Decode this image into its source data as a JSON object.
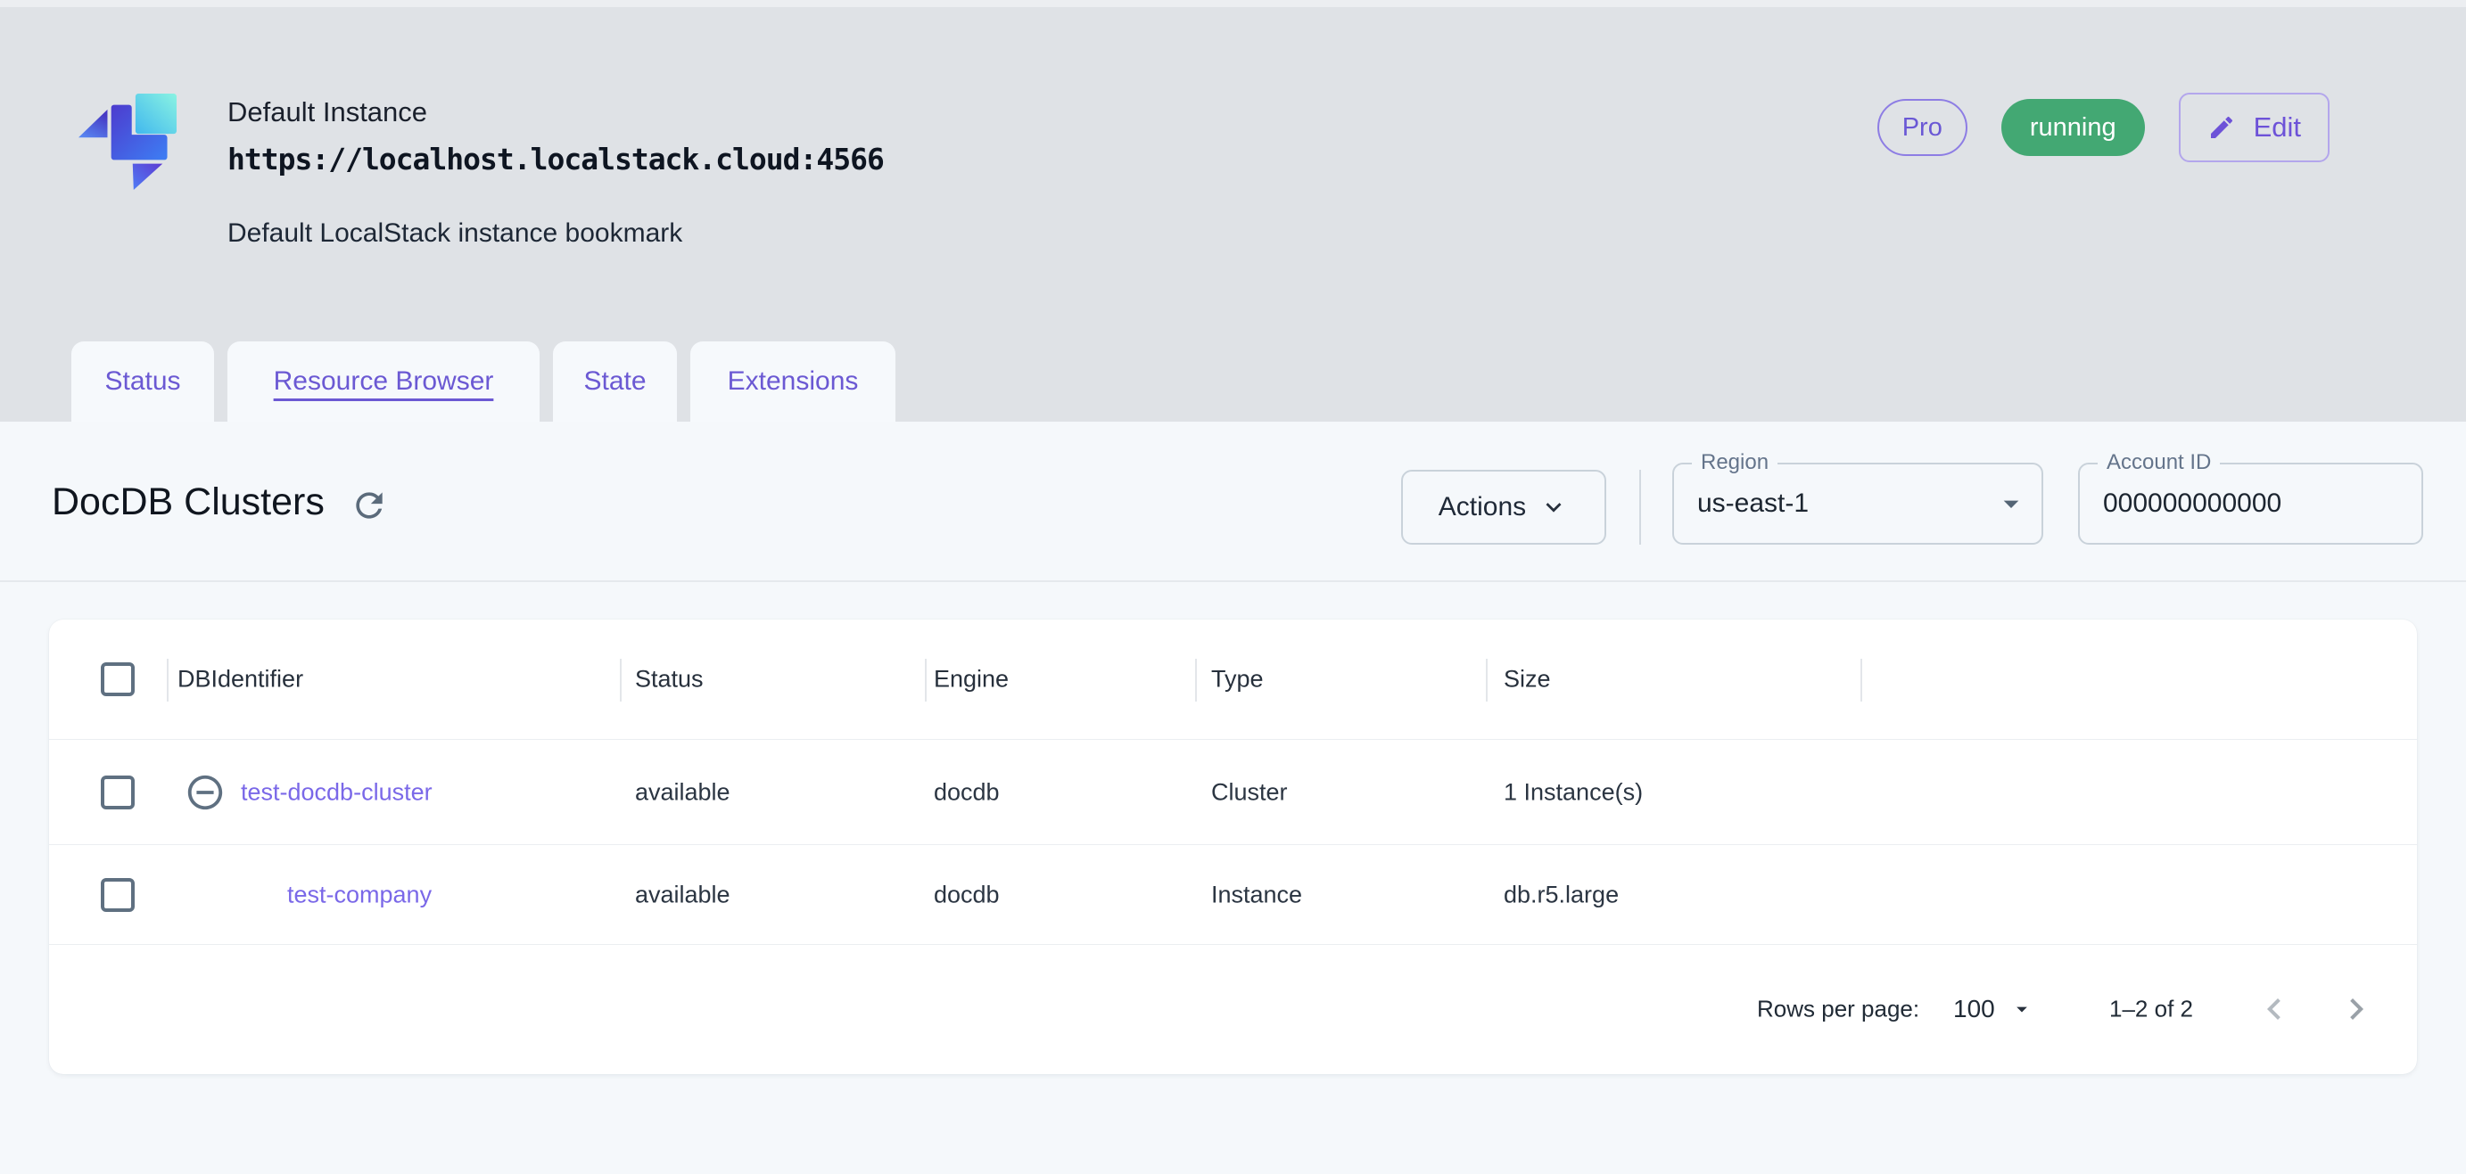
{
  "header": {
    "title": "Default Instance",
    "url": "https://localhost.localstack.cloud:4566",
    "subtitle": "Default LocalStack instance bookmark",
    "pro_badge": "Pro",
    "status_badge": "running",
    "edit_button": "Edit"
  },
  "tabs": [
    {
      "label": "Status"
    },
    {
      "label": "Resource Browser"
    },
    {
      "label": "State"
    },
    {
      "label": "Extensions"
    }
  ],
  "toolbar": {
    "page_title": "DocDB Clusters",
    "actions_button": "Actions",
    "region": {
      "label": "Region",
      "value": "us-east-1"
    },
    "account_id": {
      "label": "Account ID",
      "value": "000000000000"
    }
  },
  "table": {
    "columns": [
      "DBIdentifier",
      "Status",
      "Engine",
      "Type",
      "Size"
    ],
    "rows": [
      {
        "dbidentifier": "test-docdb-cluster",
        "status": "available",
        "engine": "docdb",
        "type": "Cluster",
        "size": "1 Instance(s)"
      },
      {
        "dbidentifier": "test-company",
        "status": "available",
        "engine": "docdb",
        "type": "Instance",
        "size": "db.r5.large"
      }
    ]
  },
  "pagination": {
    "rows_per_page_label": "Rows per page:",
    "rows_per_page_value": "100",
    "range_label": "1–2 of 2"
  },
  "colors": {
    "accent_purple": "#6d52d8",
    "link_purple": "#7a68e8",
    "running_green": "#43a873",
    "slate": "#5f7081"
  }
}
